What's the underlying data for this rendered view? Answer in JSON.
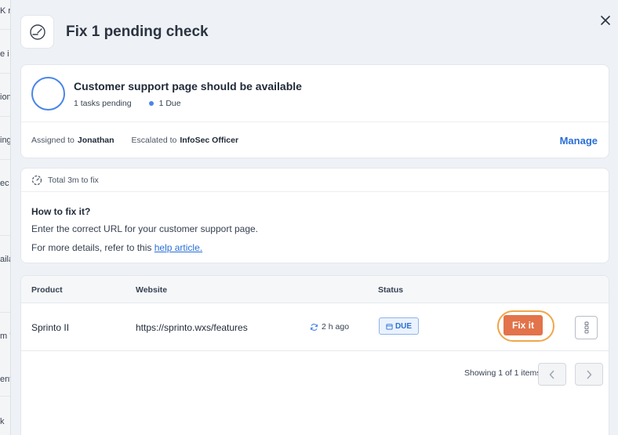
{
  "background": {
    "fragments": [
      "K r",
      "e i",
      "ion",
      "ing",
      "ec",
      "aila",
      "m '",
      "ent",
      "k"
    ]
  },
  "header": {
    "title": "Fix 1 pending check"
  },
  "check": {
    "title": "Customer support page should be available",
    "tasks_pending": "1 tasks pending",
    "due": "1 Due",
    "assigned_label": "Assigned to",
    "assigned_to": "Jonathan",
    "escalated_label": "Escalated to",
    "escalated_to": "InfoSec Officer",
    "manage_label": "Manage"
  },
  "fix_info": {
    "time_to_fix": "Total 3m to fix",
    "howto_title": "How to fix it?",
    "howto_text": "Enter the correct URL for your customer support page.",
    "details_prefix": "For more details, refer to this ",
    "help_link": "help article."
  },
  "table": {
    "columns": [
      "Product",
      "Website",
      "Status"
    ],
    "rows": [
      {
        "product": "Sprinto II",
        "website": "https://sprinto.wxs/features",
        "synced": "2 h ago",
        "status": "DUE",
        "action": "Fix it"
      }
    ],
    "showing": "Showing 1 of 1 items"
  },
  "colors": {
    "accent": "#2a6fd6",
    "fix_button": "#e2734a",
    "highlight_ring": "#f0a64a",
    "ring_blue": "#4a86e8"
  }
}
